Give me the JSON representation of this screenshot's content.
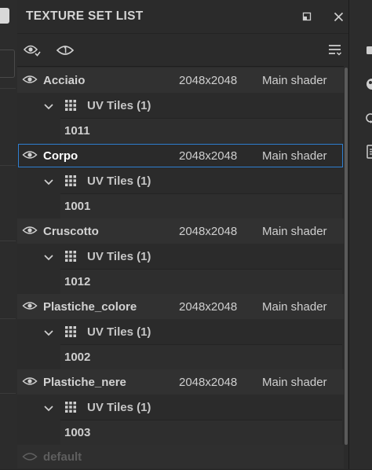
{
  "panel": {
    "title": "TEXTURE SET LIST"
  },
  "header_icons": [
    "maximize-icon",
    "close-icon"
  ],
  "toolbar_icons": [
    "visibility-toggle-icon",
    "solo-visibility-icon",
    "list-options-icon"
  ],
  "texture_sets": [
    {
      "name": "Acciaio",
      "resolution": "2048x2048",
      "shader": "Main shader",
      "uv_label": "UV Tiles (1)",
      "tile": "1011",
      "selected": false
    },
    {
      "name": "Corpo",
      "resolution": "2048x2048",
      "shader": "Main shader",
      "uv_label": "UV Tiles (1)",
      "tile": "1001",
      "selected": true
    },
    {
      "name": "Cruscotto",
      "resolution": "2048x2048",
      "shader": "Main shader",
      "uv_label": "UV Tiles (1)",
      "tile": "1012",
      "selected": false
    },
    {
      "name": "Plastiche_colore",
      "resolution": "2048x2048",
      "shader": "Main shader",
      "uv_label": "UV Tiles (1)",
      "tile": "1002",
      "selected": false
    },
    {
      "name": "Plastiche_nere",
      "resolution": "2048x2048",
      "shader": "Main shader",
      "uv_label": "UV Tiles (1)",
      "tile": "1003",
      "selected": false
    }
  ],
  "default_set": {
    "name": "default"
  },
  "colors": {
    "panel_bg": "#2b2b2b",
    "row_bg": "#313131",
    "selection_outline": "#2f7fd1",
    "text": "#d2d2d2",
    "disabled_text": "#5e5e5e"
  }
}
